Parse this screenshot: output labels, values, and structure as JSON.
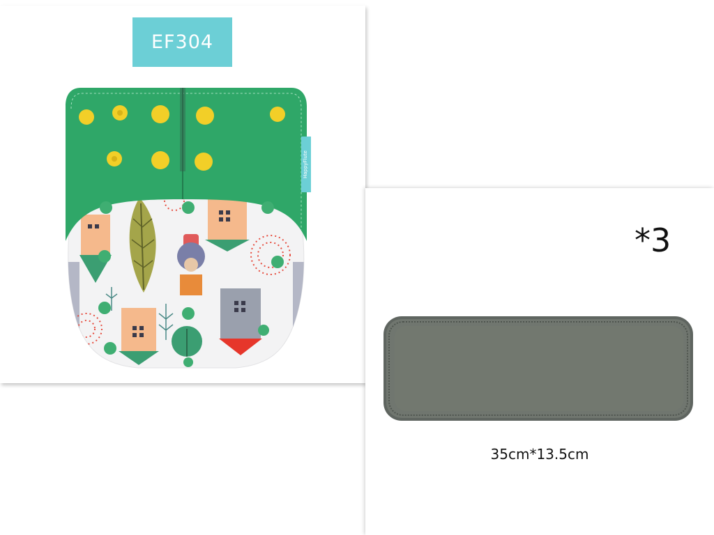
{
  "product": {
    "sku": "EF304",
    "brand_tag": "HappyFlute",
    "colors": {
      "badge": "#6ccfd6",
      "waistband": "#2fa768",
      "snap_yellow": "#f2cf28",
      "snap_green": "#3fae72",
      "insert_gray": "#6f7570"
    }
  },
  "insert": {
    "quantity_label": "*3",
    "dimensions_label": "35cm*13.5cm"
  }
}
